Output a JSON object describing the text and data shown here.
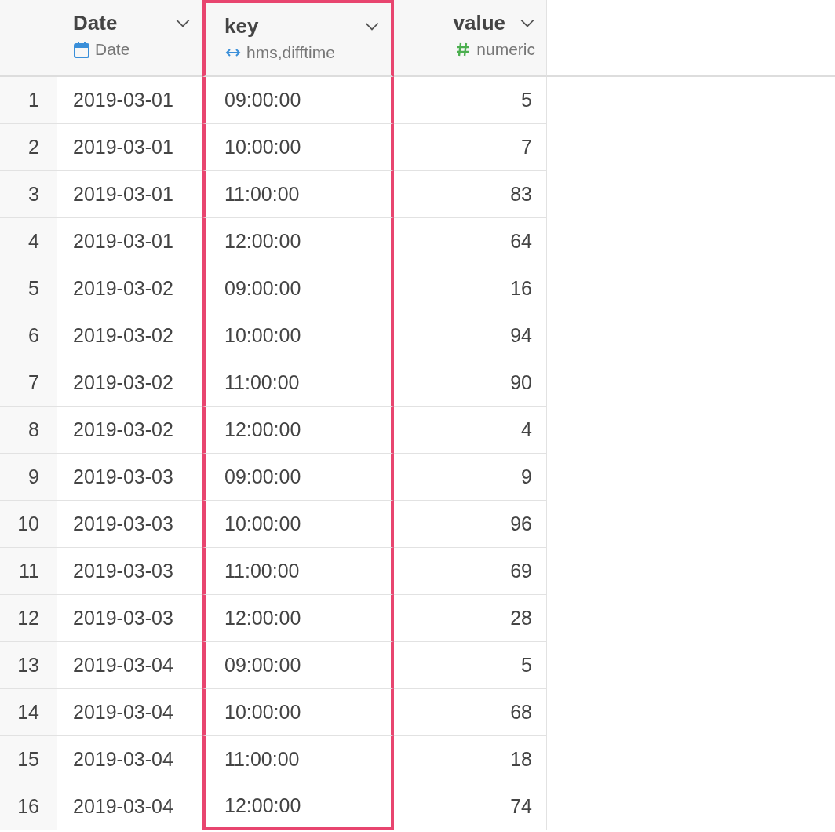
{
  "table": {
    "columns": [
      {
        "name": "Date",
        "type": "Date",
        "kind": "date",
        "selected": false
      },
      {
        "name": "key",
        "type": "hms,difftime",
        "kind": "difftime",
        "selected": true
      },
      {
        "name": "value",
        "type": "numeric",
        "kind": "numeric",
        "selected": false
      }
    ],
    "rows": [
      {
        "index": "1",
        "cells": [
          "2019-03-01",
          "09:00:00",
          "5"
        ]
      },
      {
        "index": "2",
        "cells": [
          "2019-03-01",
          "10:00:00",
          "7"
        ]
      },
      {
        "index": "3",
        "cells": [
          "2019-03-01",
          "11:00:00",
          "83"
        ]
      },
      {
        "index": "4",
        "cells": [
          "2019-03-01",
          "12:00:00",
          "64"
        ]
      },
      {
        "index": "5",
        "cells": [
          "2019-03-02",
          "09:00:00",
          "16"
        ]
      },
      {
        "index": "6",
        "cells": [
          "2019-03-02",
          "10:00:00",
          "94"
        ]
      },
      {
        "index": "7",
        "cells": [
          "2019-03-02",
          "11:00:00",
          "90"
        ]
      },
      {
        "index": "8",
        "cells": [
          "2019-03-02",
          "12:00:00",
          "4"
        ]
      },
      {
        "index": "9",
        "cells": [
          "2019-03-03",
          "09:00:00",
          "9"
        ]
      },
      {
        "index": "10",
        "cells": [
          "2019-03-03",
          "10:00:00",
          "96"
        ]
      },
      {
        "index": "11",
        "cells": [
          "2019-03-03",
          "11:00:00",
          "69"
        ]
      },
      {
        "index": "12",
        "cells": [
          "2019-03-03",
          "12:00:00",
          "28"
        ]
      },
      {
        "index": "13",
        "cells": [
          "2019-03-04",
          "09:00:00",
          "5"
        ]
      },
      {
        "index": "14",
        "cells": [
          "2019-03-04",
          "10:00:00",
          "68"
        ]
      },
      {
        "index": "15",
        "cells": [
          "2019-03-04",
          "11:00:00",
          "18"
        ]
      },
      {
        "index": "16",
        "cells": [
          "2019-03-04",
          "12:00:00",
          "74"
        ]
      }
    ]
  }
}
